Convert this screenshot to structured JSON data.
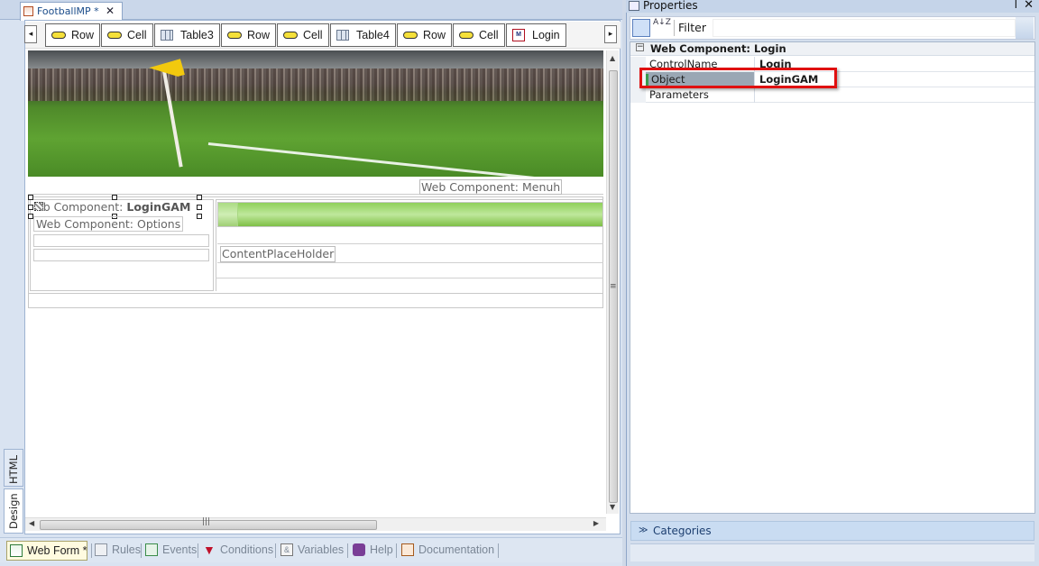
{
  "document_tab": {
    "title": "FootballMP *",
    "close_glyph": "✕"
  },
  "breadcrumb": {
    "left_arrow": "◂",
    "right_arrow": "▸",
    "items": [
      {
        "label": "Row",
        "icon": "row-icon"
      },
      {
        "label": "Cell",
        "icon": "cell-icon"
      },
      {
        "label": "Table3",
        "icon": "table-icon"
      },
      {
        "label": "Row",
        "icon": "row-icon"
      },
      {
        "label": "Cell",
        "icon": "cell-icon"
      },
      {
        "label": "Table4",
        "icon": "table-icon"
      },
      {
        "label": "Row",
        "icon": "row-icon"
      },
      {
        "label": "Cell",
        "icon": "cell-icon"
      },
      {
        "label": "Login",
        "icon": "login-icon"
      }
    ]
  },
  "canvas": {
    "menuh_label": "Web Component: Menuh",
    "login_label_prefix": "eb Component: ",
    "login_label_bold": "LoginGAM",
    "options_label": "Web Component: Options",
    "content_placeholder": "ContentPlaceHolder"
  },
  "side_tabs": {
    "html": "HTML",
    "design": "Design"
  },
  "bottom_tabs": [
    {
      "label": "Web Form *",
      "active": true
    },
    {
      "label": "Rules"
    },
    {
      "label": "Events"
    },
    {
      "label": "Conditions"
    },
    {
      "label": "Variables"
    },
    {
      "label": "Help"
    },
    {
      "label": "Documentation"
    }
  ],
  "properties": {
    "title": "Properties",
    "pin_glyph": "ᵖ",
    "close_glyph": "✕",
    "filter_label": "Filter",
    "sort_glyph": "A↓Z",
    "section_title": "Web Component: Login",
    "section_toggle": "−",
    "rows": [
      {
        "name": "ControlName",
        "value": "Login"
      },
      {
        "name": "Object",
        "value": "LoginGAM"
      },
      {
        "name": "Parameters",
        "value": ""
      }
    ],
    "categories_label": "Categories",
    "categories_glyph": "≫"
  },
  "colors": {
    "highlight": "#e01010",
    "object_marker": "#3a9a4c"
  }
}
